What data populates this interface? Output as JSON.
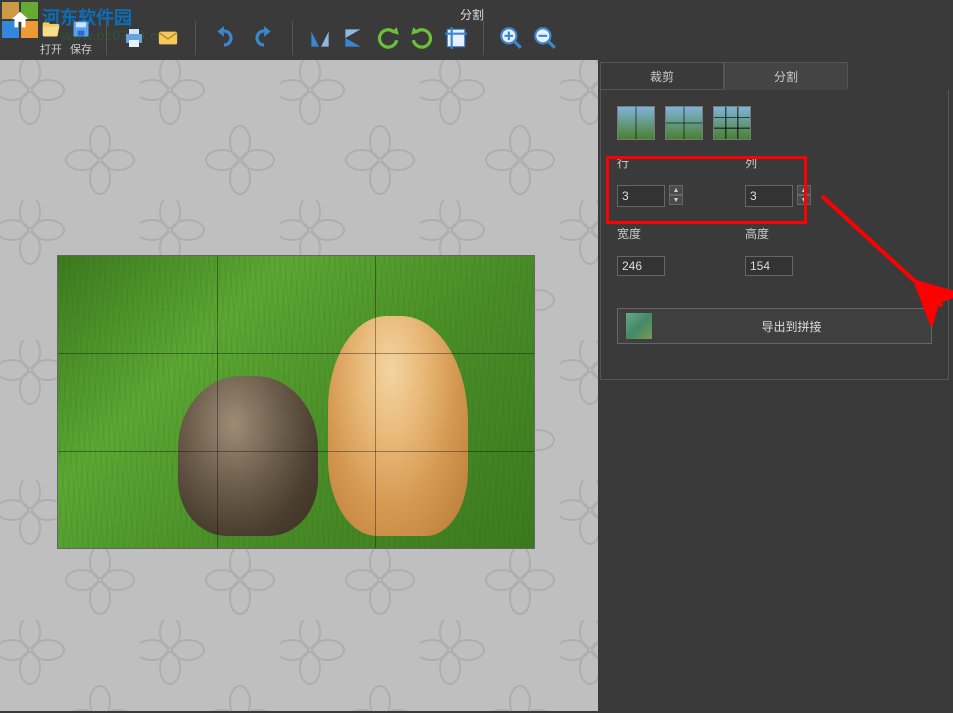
{
  "brand": {
    "name": "河东软件园",
    "url": "www.pc0359.cn"
  },
  "top_label": "分割",
  "toolbar": {
    "open": "打开",
    "save": "保存"
  },
  "tabs": {
    "crop": "裁剪",
    "split": "分割"
  },
  "panel": {
    "rows_label": "行",
    "cols_label": "列",
    "rows_value": "3",
    "cols_value": "3",
    "width_label": "宽度",
    "height_label": "高度",
    "width_value": "246",
    "height_value": "154",
    "export_label": "导出到拼接"
  },
  "chart_data": null
}
